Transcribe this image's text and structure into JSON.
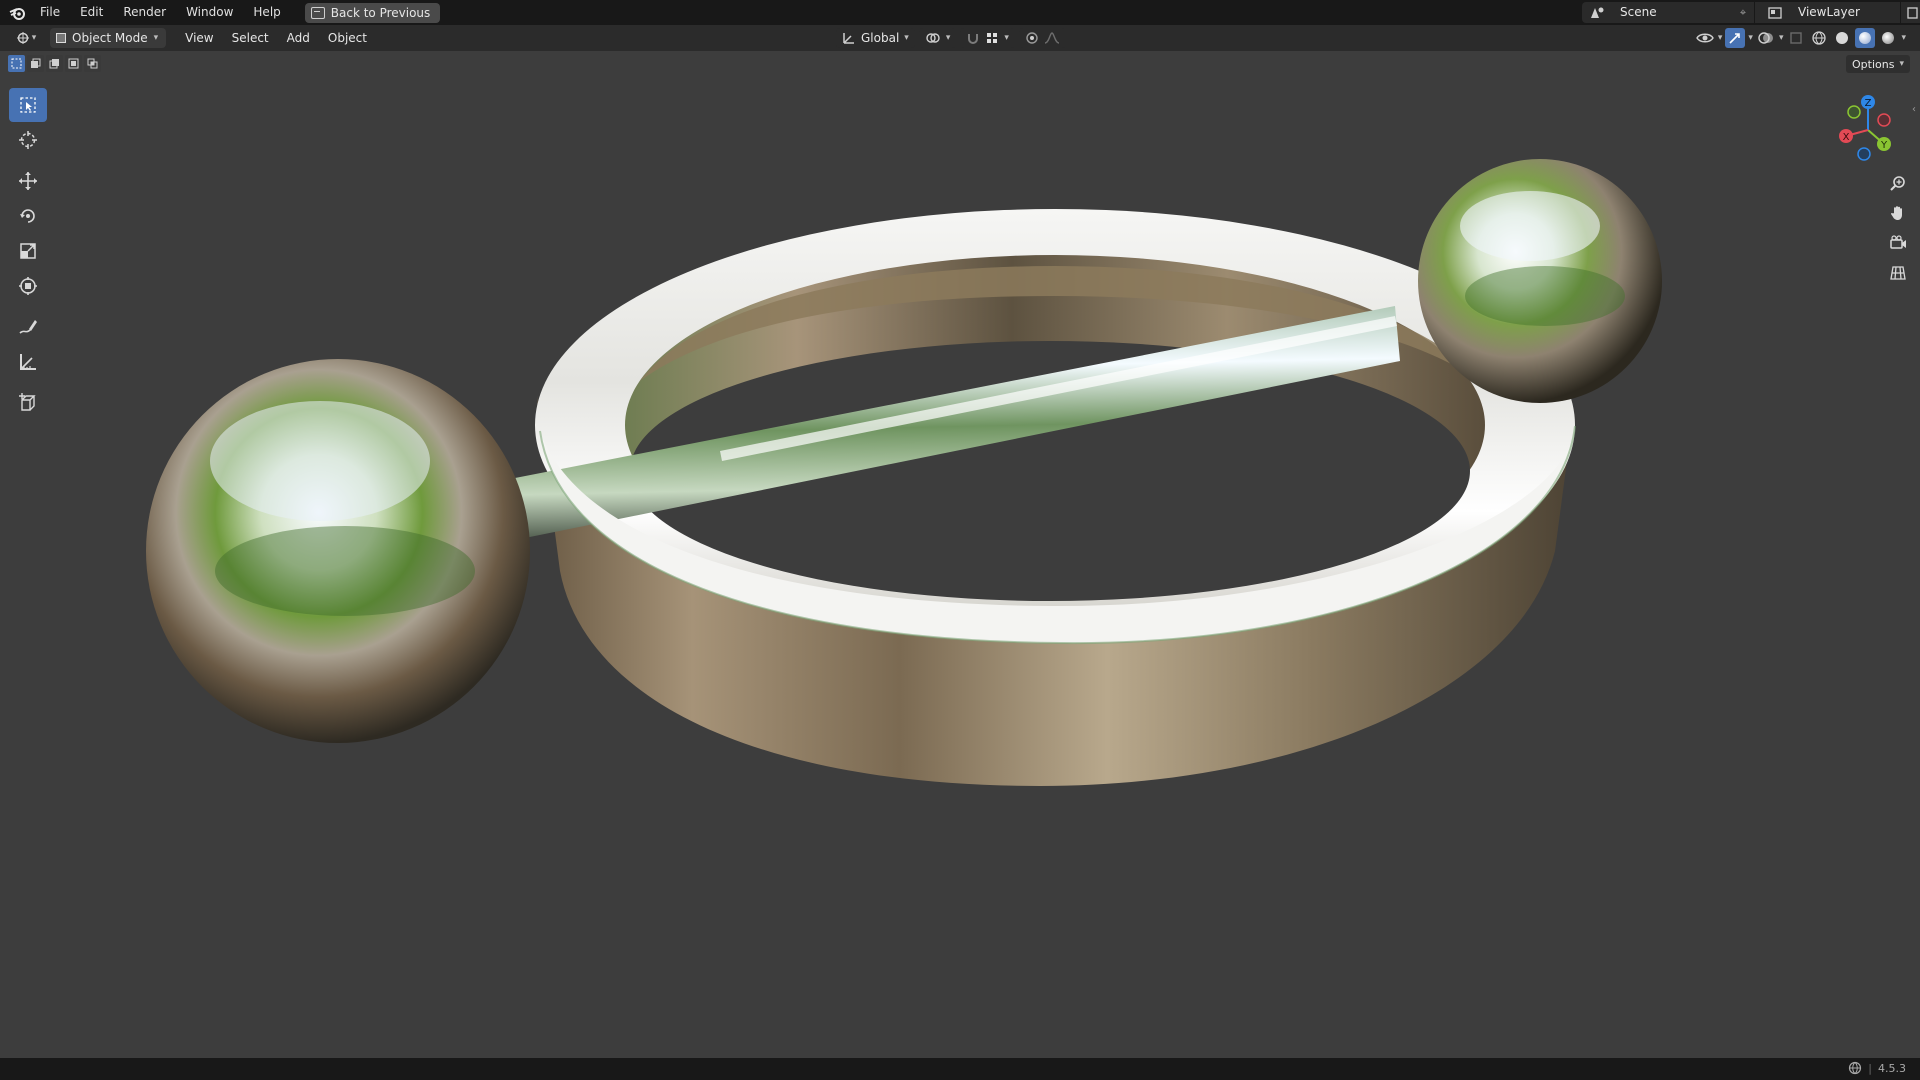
{
  "topbar": {
    "menus": [
      "File",
      "Edit",
      "Render",
      "Window",
      "Help"
    ],
    "back_button": "Back to Previous",
    "scene_name": "Scene",
    "view_layer": "ViewLayer"
  },
  "viewport_header": {
    "mode": "Object Mode",
    "menus": [
      "View",
      "Select",
      "Add",
      "Object"
    ],
    "transform_orientation": "Global",
    "options": "Options"
  },
  "toolbar": {
    "tools": [
      "select-box",
      "cursor",
      "move",
      "rotate",
      "scale",
      "transform",
      "annotate",
      "measure",
      "add-cube"
    ],
    "active_tool": "select-box"
  },
  "gizmo": {
    "axes": [
      "X",
      "Y",
      "Z"
    ],
    "colors": {
      "x": "#e34a55",
      "y": "#8ac532",
      "z": "#2e87e8"
    }
  },
  "statusbar": {
    "version": "4.5.3"
  },
  "viewport": {
    "background": "#3d3d3d",
    "objects": [
      "ring",
      "rod",
      "sphere-left",
      "sphere-right"
    ],
    "material": "chrome"
  },
  "colors": {
    "accent": "#4772b3",
    "header": "#2b2b2b",
    "topbar": "#181818"
  }
}
